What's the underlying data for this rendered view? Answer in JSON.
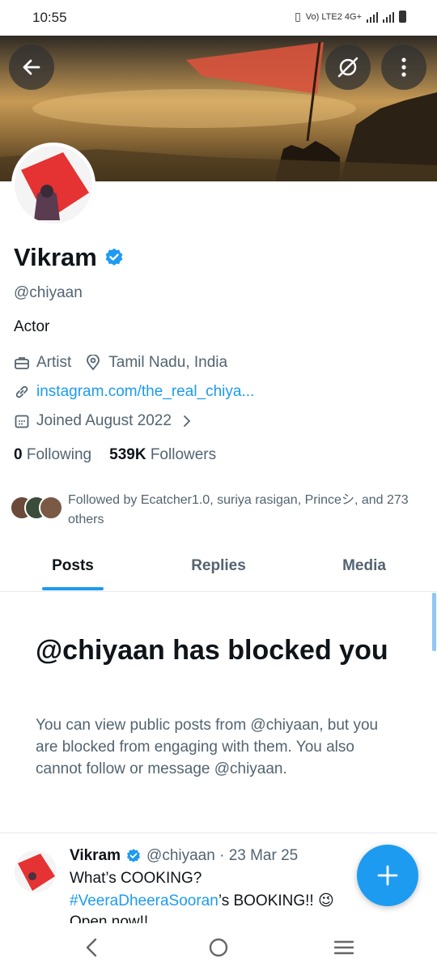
{
  "status_bar": {
    "time": "10:55",
    "network": "Vo) LTE2 4G+"
  },
  "profile": {
    "name": "Vikram",
    "handle": "@chiyaan",
    "bio": "Actor",
    "category": "Artist",
    "location": "Tamil Nadu, India",
    "website": "instagram.com/the_real_chiya...",
    "joined": "Joined August 2022",
    "following_count": "0",
    "following_label": "Following",
    "followers_count": "539K",
    "followers_label": "Followers",
    "followed_by_text": "Followed by Ecatcher1.0, suriya rasigan, Princeシ, and 273 others"
  },
  "tabs": [
    {
      "label": "Posts",
      "active": true
    },
    {
      "label": "Replies",
      "active": false
    },
    {
      "label": "Media",
      "active": false
    }
  ],
  "blocked": {
    "title": "@chiyaan has blocked you",
    "body": "You can view public posts from @chiyaan, but you are blocked from engaging with them. You also cannot follow or message @chiyaan."
  },
  "post": {
    "author": "Vikram",
    "meta": "@chiyaan · 23 Mar 25",
    "line1": "What’s COOKING?",
    "hashtag": "#VeeraDheeraSooran",
    "line2_rest": "’s BOOKING!! 😉",
    "line3": "Open now!!"
  },
  "colors": {
    "accent": "#1d9bf0",
    "text": "#0f1419",
    "muted": "#536471"
  },
  "icons": [
    "back-arrow-icon",
    "no-signal-circle-icon",
    "more-vertical-icon",
    "verified-badge-icon",
    "briefcase-icon",
    "location-pin-icon",
    "link-icon",
    "calendar-icon",
    "chevron-right-icon",
    "plus-icon",
    "nav-back-icon",
    "nav-home-icon",
    "nav-recents-icon"
  ]
}
